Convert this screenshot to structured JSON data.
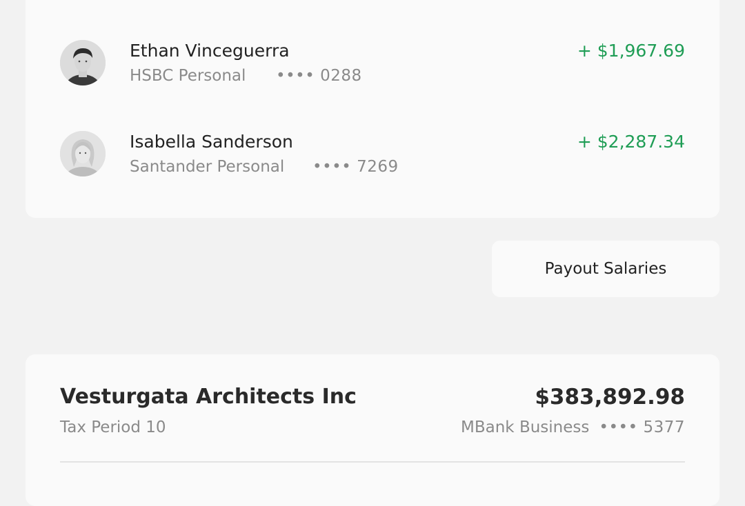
{
  "payees": [
    {
      "name": "Ethan Vinceguerra",
      "bank": "HSBC Personal",
      "account": "•••• 0288",
      "amount": "+ $1,967.69"
    },
    {
      "name": "Isabella Sanderson",
      "bank": "Santander Personal",
      "account": "•••• 7269",
      "amount": "+ $2,287.34"
    }
  ],
  "actions": {
    "payout_label": "Payout Salaries"
  },
  "company": {
    "name": "Vesturgata Architects Inc",
    "total": "$383,892.98",
    "period": "Tax Period 10",
    "bank": "MBank Business",
    "account": "•••• 5377"
  },
  "colors": {
    "positive_amount": "#1f9d55",
    "secondary_text": "#8a8a8a",
    "card_bg": "#fafafa",
    "page_bg": "#f2f2f2"
  }
}
